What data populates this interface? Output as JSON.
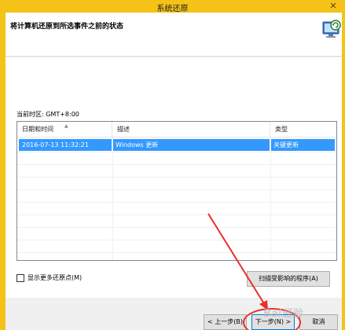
{
  "window": {
    "title": "系统还原",
    "close_glyph": "✕"
  },
  "header": {
    "title": "将计算机还原到所选事件之前的状态",
    "icon": "system-restore-icon"
  },
  "timezone": {
    "label": "当前时区: GMT+8:00"
  },
  "restore_list": {
    "columns": [
      "日期和时间",
      "描述",
      "类型"
    ],
    "rows": [
      {
        "date": "2016-07-13 11:32:21",
        "description": "Windows 更新",
        "type": "关键更新",
        "selected": true
      }
    ]
  },
  "show_more": {
    "label": "显示更多还原点(M)",
    "checked": false
  },
  "buttons": {
    "scan": "扫描受影响的程序(A)",
    "prev": "< 上一步(B)",
    "next": "下一步(N) >",
    "cancel": "取消"
  },
  "watermark": {
    "text": "Bai经验"
  },
  "colors": {
    "title_bar": "#f5c218",
    "selection": "#3399ff",
    "annotation": "#e8302a"
  }
}
